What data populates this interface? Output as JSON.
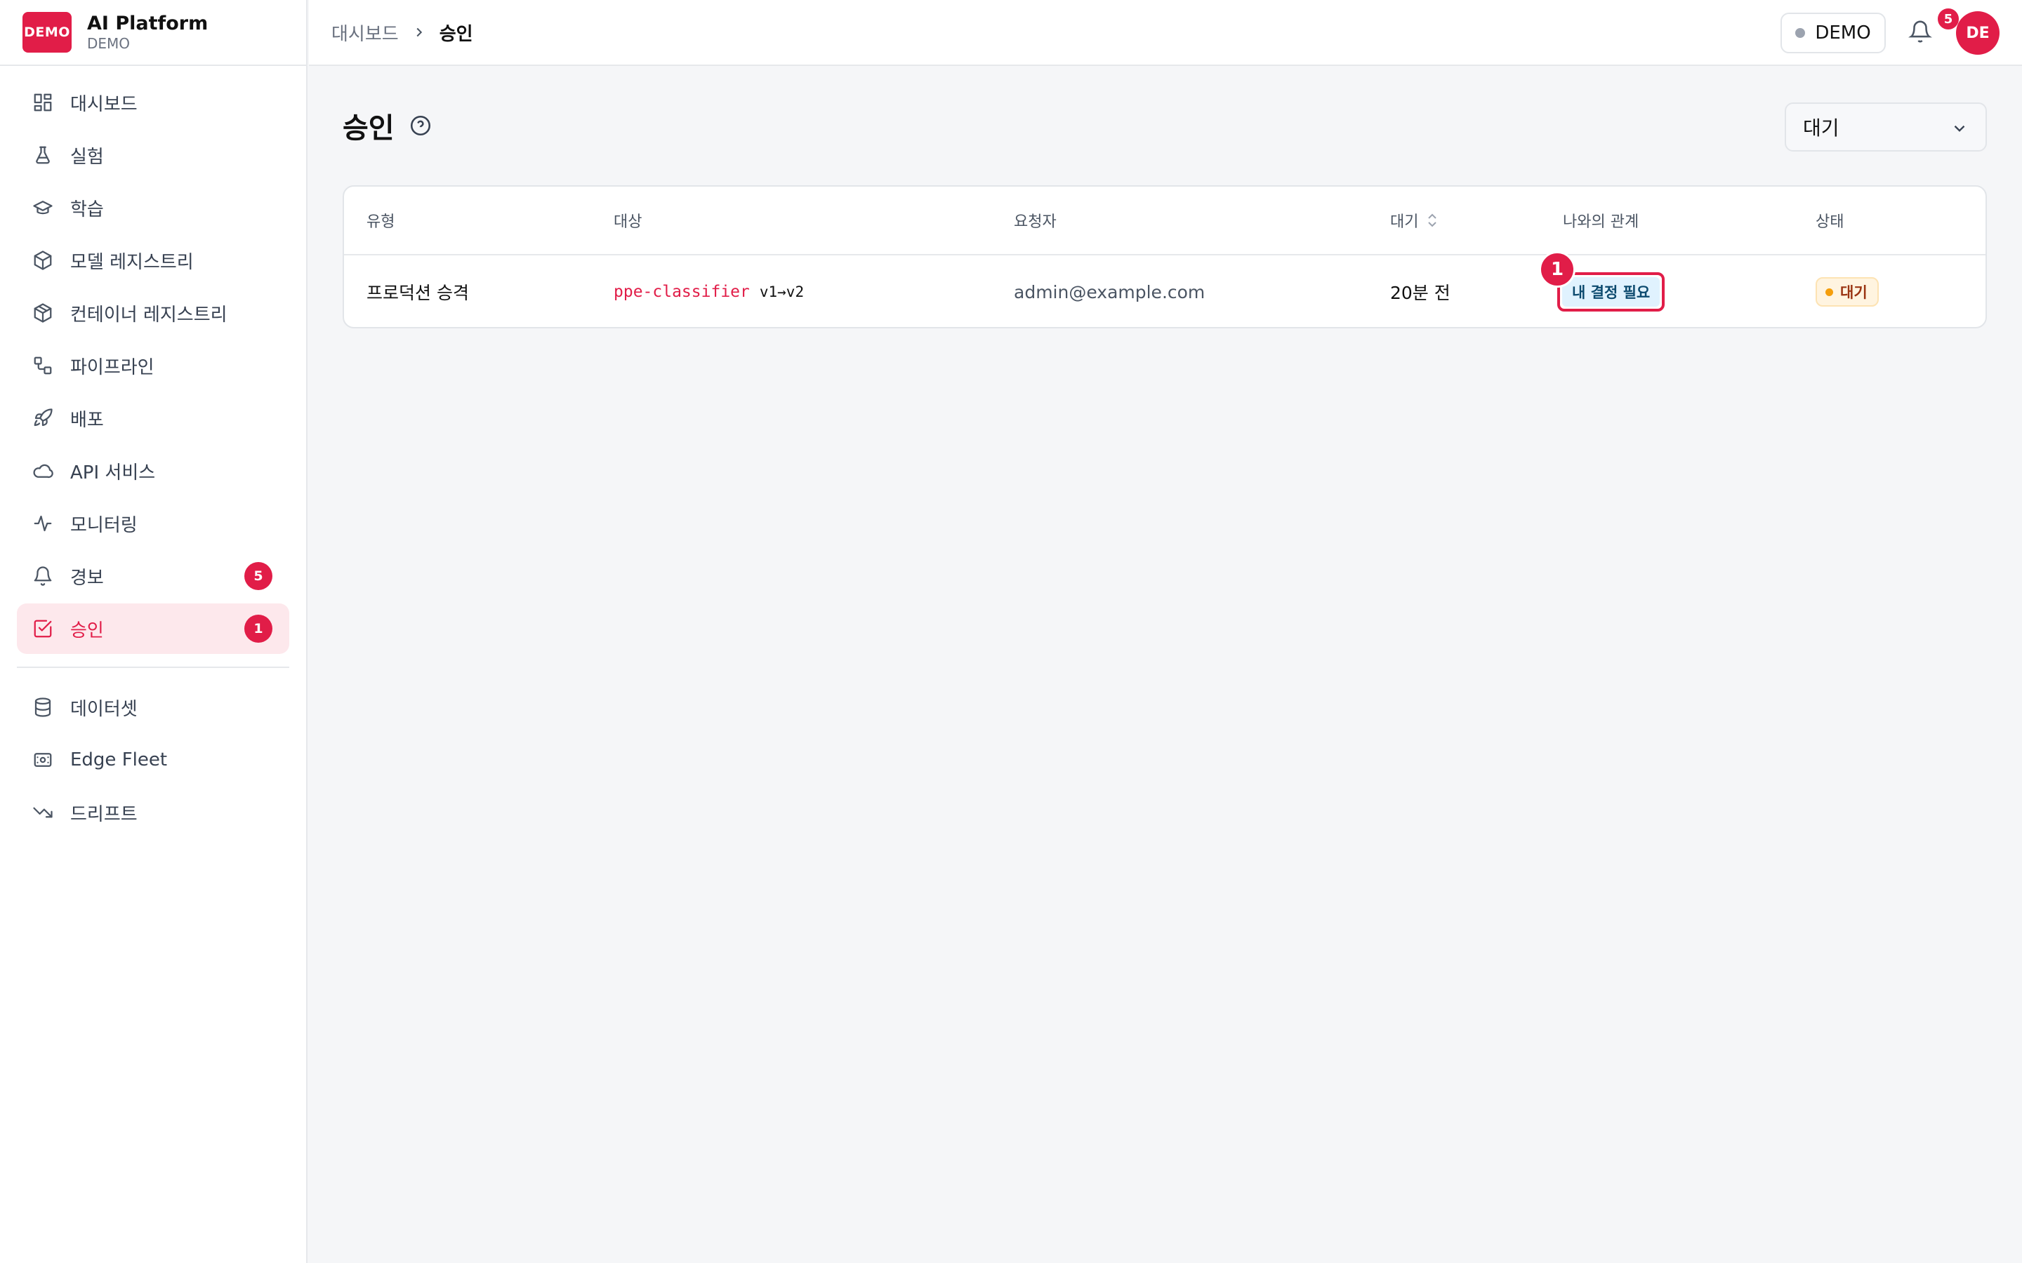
{
  "brand": {
    "logo_text": "DEMO",
    "name": "AI Platform",
    "sub": "DEMO"
  },
  "sidebar": {
    "items": [
      {
        "label": "대시보드",
        "icon": "dashboard-icon"
      },
      {
        "label": "실험",
        "icon": "flask-icon"
      },
      {
        "label": "학습",
        "icon": "graduation-cap-icon"
      },
      {
        "label": "모델 레지스트리",
        "icon": "cube-icon"
      },
      {
        "label": "컨테이너 레지스트리",
        "icon": "package-icon"
      },
      {
        "label": "파이프라인",
        "icon": "workflow-icon"
      },
      {
        "label": "배포",
        "icon": "rocket-icon"
      },
      {
        "label": "API 서비스",
        "icon": "cloud-icon"
      },
      {
        "label": "모니터링",
        "icon": "activity-icon"
      },
      {
        "label": "경보",
        "icon": "bell-icon",
        "badge": "5"
      },
      {
        "label": "승인",
        "icon": "check-square-icon",
        "badge": "1",
        "active": true
      }
    ],
    "secondary": [
      {
        "label": "데이터셋",
        "icon": "database-icon"
      },
      {
        "label": "Edge Fleet",
        "icon": "router-icon"
      },
      {
        "label": "드리프트",
        "icon": "trending-down-icon"
      }
    ]
  },
  "header": {
    "breadcrumb_root": "대시보드",
    "breadcrumb_current": "승인",
    "env_label": "DEMO",
    "notification_count": "5",
    "avatar_initials": "DE"
  },
  "main": {
    "title": "승인",
    "filter_value": "대기",
    "table": {
      "columns": [
        "유형",
        "대상",
        "요청자",
        "대기",
        "나와의 관계",
        "상태"
      ],
      "rows": [
        {
          "type": "프로덕션 승격",
          "target_name": "ppe-classifier",
          "target_version": "v1→v2",
          "requester": "admin@example.com",
          "waiting": "20분 전",
          "relation": "내 결정 필요",
          "status": "대기"
        }
      ]
    },
    "annotation_marker": "1"
  },
  "colors": {
    "accent": "#e11d48",
    "status_pending": "#f59e0b",
    "relation_badge_bg": "#e0f2fe"
  }
}
